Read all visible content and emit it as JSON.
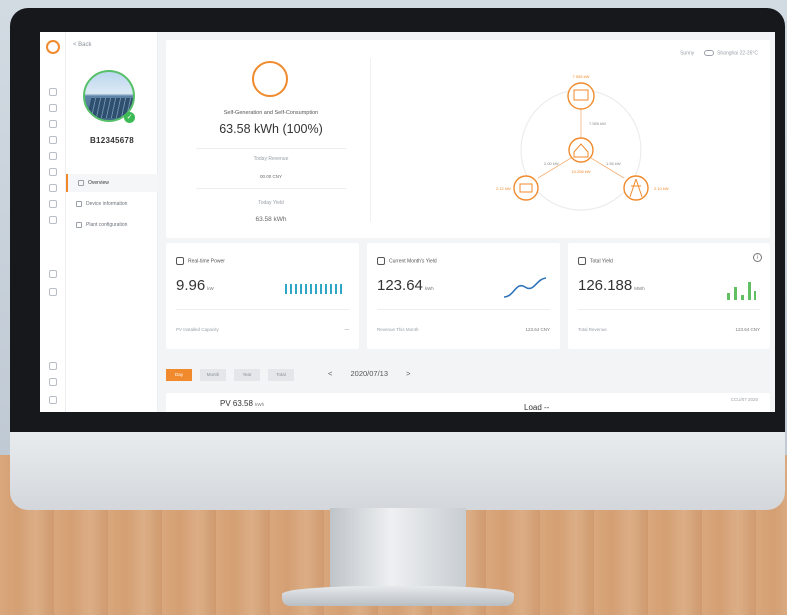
{
  "navigation": {
    "back_label": "< Back",
    "plant_serial": "B12345678",
    "menu_items": [
      {
        "label": "Overview",
        "active": true
      },
      {
        "label": "Device information",
        "active": false
      },
      {
        "label": "Plant configuration",
        "active": false
      }
    ]
  },
  "weather": {
    "label": "Sunny",
    "location": "Shanghai",
    "temperature": "22-26°C"
  },
  "energy_flow": {
    "generation_label": "Self-Generation and Self-Consumption",
    "generation_value": "63.58 kWh (100%)",
    "today_revenue_label": "Today Revenue",
    "today_revenue_value": "00.00 CNY",
    "today_yield_label": "Today Yield",
    "today_yield_value": "63.58 kWh",
    "nodes": {
      "pv_value": "7.555 kW",
      "pv_to_home": "7.555 kW",
      "battery_value": "2.12 kW",
      "battery_flow": "2.00 kW",
      "grid_flow": "1.55 kW",
      "grid_value": "2.10 kW",
      "home_value": "10.256 kW"
    }
  },
  "stats": [
    {
      "title": "Real-time Power",
      "value": "9.96",
      "unit": "kW",
      "foot_label": "PV Installed Capacity",
      "foot_value": "—",
      "chart": "bars"
    },
    {
      "title": "Current Month's Yield",
      "value": "123.64",
      "unit": "kWh",
      "foot_label": "Revenue This Month",
      "foot_value": "123.64 CNY",
      "chart": "wave"
    },
    {
      "title": "Total Yield",
      "value": "126.188",
      "unit": "MWh",
      "foot_label": "Total Revenue",
      "foot_value": "123.64 CNY",
      "chart": "columns",
      "info_icon": "i"
    }
  ],
  "period_tabs": [
    "Day",
    "Month",
    "Year",
    "Total"
  ],
  "period_active": "Day",
  "date_nav": {
    "prev": "<",
    "date": "2020/07/13",
    "next": ">"
  },
  "bottom_chart": {
    "pv_label": "PV 63.58",
    "pv_unit": "kWh",
    "load_label": "Load --",
    "date_stamp": "CCU/07 2020"
  },
  "colors": {
    "accent": "#f08a2c",
    "online": "#3cba54",
    "wave": "#2f73b8",
    "bars": "#2fa7c4",
    "columns": "#5fbf62"
  },
  "icons": [
    "sun-logo-icon",
    "home-icon",
    "alarm-icon",
    "device-icon",
    "report-icon",
    "settings-icon",
    "calendar-icon",
    "info-icon"
  ]
}
